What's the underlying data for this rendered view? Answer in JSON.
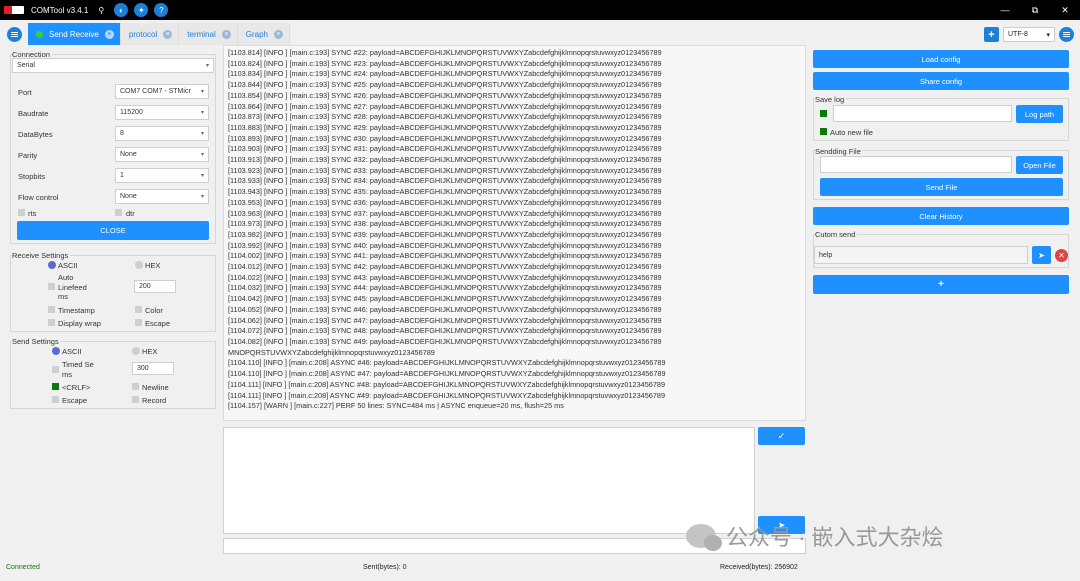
{
  "window": {
    "title": "COMTool v3.4.1",
    "controls": [
      "—",
      "⧉",
      "✕"
    ]
  },
  "tabs": [
    {
      "label": "Send Receive",
      "active": true
    },
    {
      "label": "protocol",
      "active": false
    },
    {
      "label": "terminal",
      "active": false
    },
    {
      "label": "Graph",
      "active": false
    }
  ],
  "encoding": {
    "value": "UTF-8"
  },
  "connection": {
    "title": "Connection",
    "type": "Serial",
    "port_label": "Port",
    "port_value": "COM7 COM7 - STMicr",
    "baud_label": "Baudrate",
    "baud_value": "115200",
    "databytes_label": "DataBytes",
    "databytes_value": "8",
    "parity_label": "Parity",
    "parity_value": "None",
    "stopbits_label": "Stopbits",
    "stopbits_value": "1",
    "flow_label": "Flow control",
    "flow_value": "None",
    "rts_label": "rts",
    "dtr_label": "dtr",
    "close_label": "CLOSE"
  },
  "receive_settings": {
    "title": "Receive Settings",
    "ascii": "ASCII",
    "hex": "HEX",
    "auto_linefeed": "Auto Linefeed ms",
    "auto_linefeed_value": "200",
    "timestamp": "Timestamp",
    "color": "Color",
    "display_wrap": "Display wrap",
    "escape": "Escape"
  },
  "send_settings": {
    "title": "Send Settings",
    "ascii": "ASCII",
    "hex": "HEX",
    "timed_send": "Timed Se ms",
    "timed_send_value": "300",
    "crlf": "<CRLF>",
    "newline": "Newline",
    "escape": "Escape",
    "record": "Record"
  },
  "log_lines": [
    "[1103.814] [INFO ] [main.c:193] SYNC #22: payload=ABCDEFGHIJKLMNOPQRSTUVWXYZabcdefghijklmnopqrstuvwxyz0123456789",
    "[1103.824] [INFO ] [main.c:193] SYNC #23: payload=ABCDEFGHIJKLMNOPQRSTUVWXYZabcdefghijklmnopqrstuvwxyz0123456789",
    "[1103.834] [INFO ] [main.c:193] SYNC #24: payload=ABCDEFGHIJKLMNOPQRSTUVWXYZabcdefghijklmnopqrstuvwxyz0123456789",
    "[1103.844] [INFO ] [main.c:193] SYNC #25: payload=ABCDEFGHIJKLMNOPQRSTUVWXYZabcdefghijklmnopqrstuvwxyz0123456789",
    "[1103.854] [INFO ] [main.c:193] SYNC #26: payload=ABCDEFGHIJKLMNOPQRSTUVWXYZabcdefghijklmnopqrstuvwxyz0123456789",
    "[1103.864] [INFO ] [main.c:193] SYNC #27: payload=ABCDEFGHIJKLMNOPQRSTUVWXYZabcdefghijklmnopqrstuvwxyz0123456789",
    "[1103.873] [INFO ] [main.c:193] SYNC #28: payload=ABCDEFGHIJKLMNOPQRSTUVWXYZabcdefghijklmnopqrstuvwxyz0123456789",
    "[1103.883] [INFO ] [main.c:193] SYNC #29: payload=ABCDEFGHIJKLMNOPQRSTUVWXYZabcdefghijklmnopqrstuvwxyz0123456789",
    "[1103.893] [INFO ] [main.c:193] SYNC #30: payload=ABCDEFGHIJKLMNOPQRSTUVWXYZabcdefghijklmnopqrstuvwxyz0123456789",
    "[1103.903] [INFO ] [main.c:193] SYNC #31: payload=ABCDEFGHIJKLMNOPQRSTUVWXYZabcdefghijklmnopqrstuvwxyz0123456789",
    "[1103.913] [INFO ] [main.c:193] SYNC #32: payload=ABCDEFGHIJKLMNOPQRSTUVWXYZabcdefghijklmnopqrstuvwxyz0123456789",
    "[1103.923] [INFO ] [main.c:193] SYNC #33: payload=ABCDEFGHIJKLMNOPQRSTUVWXYZabcdefghijklmnopqrstuvwxyz0123456789",
    "[1103.933] [INFO ] [main.c:193] SYNC #34: payload=ABCDEFGHIJKLMNOPQRSTUVWXYZabcdefghijklmnopqrstuvwxyz0123456789",
    "[1103.943] [INFO ] [main.c:193] SYNC #35: payload=ABCDEFGHIJKLMNOPQRSTUVWXYZabcdefghijklmnopqrstuvwxyz0123456789",
    "[1103.953] [INFO ] [main.c:193] SYNC #36: payload=ABCDEFGHIJKLMNOPQRSTUVWXYZabcdefghijklmnopqrstuvwxyz0123456789",
    "[1103.963] [INFO ] [main.c:193] SYNC #37: payload=ABCDEFGHIJKLMNOPQRSTUVWXYZabcdefghijklmnopqrstuvwxyz0123456789",
    "[1103.973] [INFO ] [main.c:193] SYNC #38: payload=ABCDEFGHIJKLMNOPQRSTUVWXYZabcdefghijklmnopqrstuvwxyz0123456789",
    "[1103.982] [INFO ] [main.c:193] SYNC #39: payload=ABCDEFGHIJKLMNOPQRSTUVWXYZabcdefghijklmnopqrstuvwxyz0123456789",
    "[1103.992] [INFO ] [main.c:193] SYNC #40: payload=ABCDEFGHIJKLMNOPQRSTUVWXYZabcdefghijklmnopqrstuvwxyz0123456789",
    "[1104.002] [INFO ] [main.c:193] SYNC #41: payload=ABCDEFGHIJKLMNOPQRSTUVWXYZabcdefghijklmnopqrstuvwxyz0123456789",
    "[1104.012] [INFO ] [main.c:193] SYNC #42: payload=ABCDEFGHIJKLMNOPQRSTUVWXYZabcdefghijklmnopqrstuvwxyz0123456789",
    "[1104.022] [INFO ] [main.c:193] SYNC #43: payload=ABCDEFGHIJKLMNOPQRSTUVWXYZabcdefghijklmnopqrstuvwxyz0123456789",
    "[1104.032] [INFO ] [main.c:193] SYNC #44: payload=ABCDEFGHIJKLMNOPQRSTUVWXYZabcdefghijklmnopqrstuvwxyz0123456789",
    "[1104.042] [INFO ] [main.c:193] SYNC #45: payload=ABCDEFGHIJKLMNOPQRSTUVWXYZabcdefghijklmnopqrstuvwxyz0123456789",
    "[1104.052] [INFO ] [main.c:193] SYNC #46: payload=ABCDEFGHIJKLMNOPQRSTUVWXYZabcdefghijklmnopqrstuvwxyz0123456789",
    "[1104.062] [INFO ] [main.c:193] SYNC #47: payload=ABCDEFGHIJKLMNOPQRSTUVWXYZabcdefghijklmnopqrstuvwxyz0123456789",
    "[1104.072] [INFO ] [main.c:193] SYNC #48: payload=ABCDEFGHIJKLMNOPQRSTUVWXYZabcdefghijklmnopqrstuvwxyz0123456789",
    "[1104.082] [INFO ] [main.c:193] SYNC #49: payload=ABCDEFGHIJKLMNOPQRSTUVWXYZabcdefghijklmnopqrstuvwxyz0123456789",
    "MNOPQRSTUVWXYZabcdefghijklmnopqrstuvwxyz0123456789",
    "[1104.110] [INFO ] [main.c:208] ASYNC #46: payload=ABCDEFGHIJKLMNOPQRSTUVWXYZabcdefghijklmnopqrstuvwxyz0123456789",
    "[1104.110] [INFO ] [main.c:208] ASYNC #47: payload=ABCDEFGHIJKLMNOPQRSTUVWXYZabcdefghijklmnopqrstuvwxyz0123456789",
    "[1104.111] [INFO ] [main.c:208] ASYNC #48: payload=ABCDEFGHIJKLMNOPQRSTUVWXYZabcdefghijklmnopqrstuvwxyz0123456789",
    "[1104.111] [INFO ] [main.c:208] ASYNC #49: payload=ABCDEFGHIJKLMNOPQRSTUVWXYZabcdefghijklmnopqrstuvwxyz0123456789",
    "[1104.157] [WARN ] [main.c:227] PERF 50 lines: SYNC=484 ms | ASYNC enqueue=20 ms, flush=25 ms"
  ],
  "right": {
    "load_config": "Load config",
    "share_config": "Share config",
    "save_log_title": "Save log",
    "log_path_button": "Log path",
    "auto_new_file": "Auto new file",
    "sending_file_title": "Sendding File",
    "open_file_button": "Open File",
    "send_file_button": "Send File",
    "clear_history": "Clear History",
    "custom_send_title": "Cutom send",
    "custom_send_value": "help",
    "add_button": "+"
  },
  "status": {
    "connection": "Connected",
    "sent": "Sent(bytes): 0",
    "received": "Received(bytes): 256902"
  },
  "watermark": {
    "text": "公众号 · 嵌入式大杂烩"
  },
  "colors": {
    "accent": "#1e90ff",
    "status_ok": "#0a7a0a",
    "titlebar": "#000000"
  }
}
